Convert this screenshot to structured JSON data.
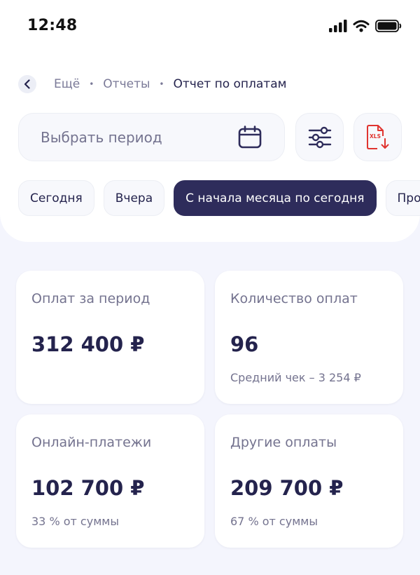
{
  "status_bar": {
    "time": "12:48",
    "icons": [
      "cellular-signal-icon",
      "wifi-icon",
      "battery-icon"
    ]
  },
  "breadcrumb": {
    "items": [
      "Ещё",
      "Отчеты",
      "Отчет по оплатам"
    ]
  },
  "period": {
    "placeholder": "Выбрать период",
    "icon": "calendar-icon"
  },
  "actions": {
    "filters_icon": "sliders-icon",
    "export_icon": "xls-download-icon",
    "export_badge": "XLS"
  },
  "chips": [
    {
      "label": "Сегодня",
      "active": false
    },
    {
      "label": "Вчера",
      "active": false
    },
    {
      "label": "С начала месяца по сегодня",
      "active": true
    },
    {
      "label": "Про",
      "active": false
    }
  ],
  "stats": {
    "total": {
      "title": "Оплат за период",
      "value": "312 400 ₽",
      "sub": ""
    },
    "count": {
      "title": "Количество оплат",
      "value": "96",
      "sub": "Средний чек – 3 254 ₽"
    },
    "online": {
      "title": "Онлайн-платежи",
      "value": "102 700 ₽",
      "sub": "33 % от суммы"
    },
    "other": {
      "title": "Другие оплаты",
      "value": "209 700 ₽",
      "sub": "67 % от суммы"
    }
  },
  "colors": {
    "accent": "#2e2c5b",
    "text_primary": "#24234d",
    "text_secondary": "#74738f",
    "background": "#f4f5fd",
    "export_red": "#e0342f"
  }
}
